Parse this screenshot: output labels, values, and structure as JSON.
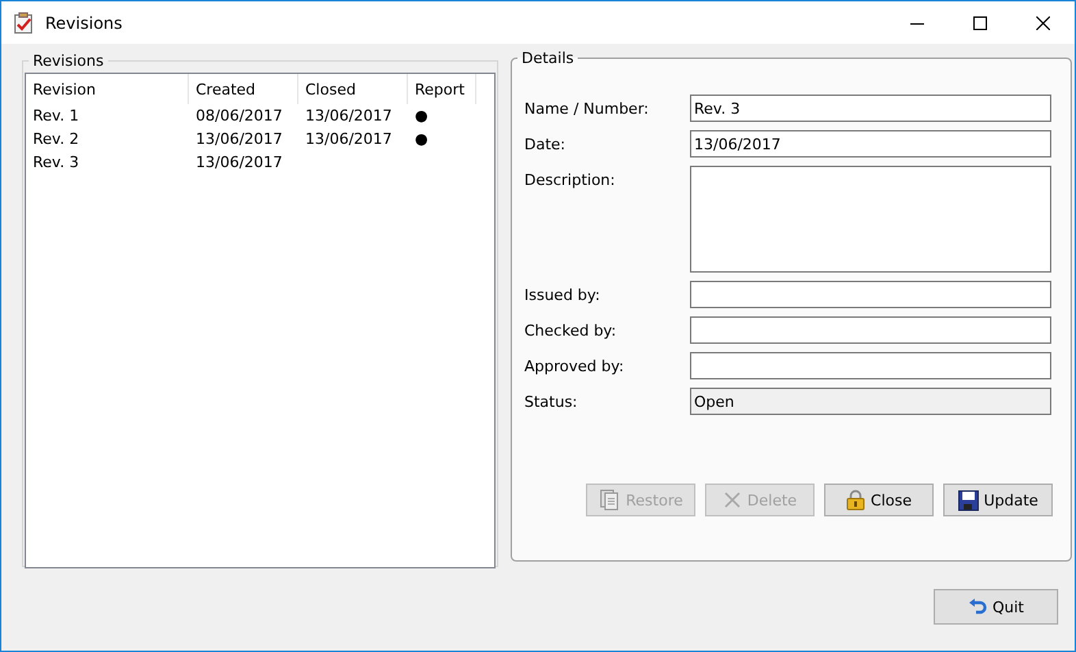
{
  "window": {
    "title": "Revisions"
  },
  "revisions": {
    "legend": "Revisions",
    "columns": [
      "Revision",
      "Created",
      "Closed",
      "Report"
    ],
    "rows": [
      {
        "cells": [
          "Rev. 1",
          "08/06/2017",
          "13/06/2017",
          "●"
        ]
      },
      {
        "cells": [
          "Rev. 2",
          "13/06/2017",
          "13/06/2017",
          "●"
        ]
      },
      {
        "cells": [
          "Rev. 3",
          "13/06/2017",
          "",
          ""
        ]
      }
    ]
  },
  "details": {
    "legend": "Details",
    "fields": [
      {
        "label": "Name / Number:",
        "value": "Rev. 3",
        "kind": "text"
      },
      {
        "label": "Date:",
        "value": "13/06/2017",
        "kind": "text"
      },
      {
        "label": "Description:",
        "kind": "textarea"
      },
      {
        "label": "Issued by:",
        "kind": "text"
      },
      {
        "label": "Checked by:",
        "kind": "text"
      },
      {
        "label": "Approved by:",
        "kind": "text"
      },
      {
        "label": "Status:",
        "value": "Open",
        "kind": "readonly"
      }
    ],
    "buttons": [
      {
        "label": "Restore",
        "kind": "restore",
        "disabled": true
      },
      {
        "label": "Delete",
        "kind": "delete",
        "disabled": true
      },
      {
        "label": "Close",
        "kind": "lock",
        "disabled": false
      },
      {
        "label": "Update",
        "kind": "save",
        "disabled": false
      }
    ]
  },
  "quit": {
    "label": "Quit"
  }
}
